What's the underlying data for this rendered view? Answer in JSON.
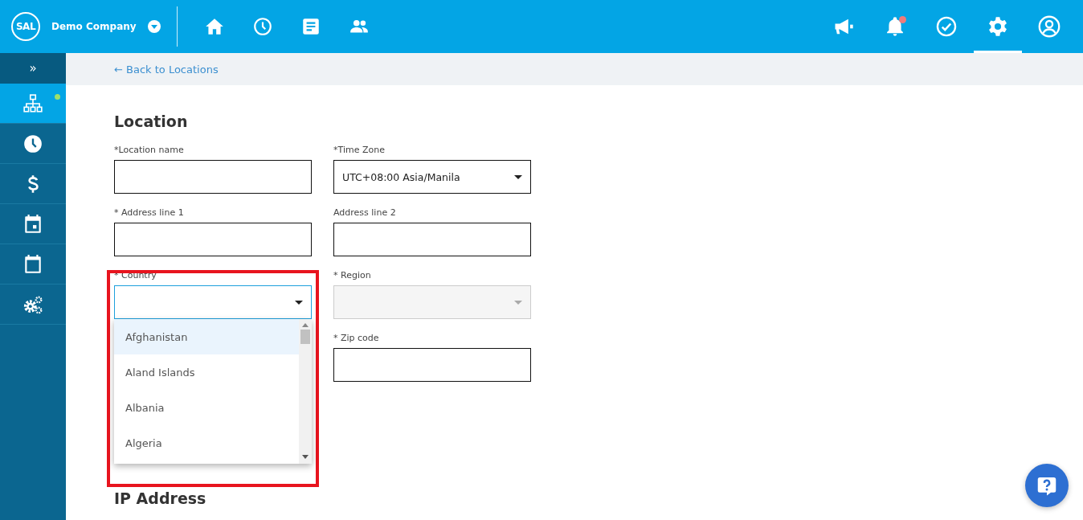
{
  "topbar": {
    "logo": "SAL",
    "company": "Demo Company",
    "nav": [
      {
        "kind": "home"
      },
      {
        "kind": "clock"
      },
      {
        "kind": "document"
      },
      {
        "kind": "people"
      }
    ],
    "actions": [
      {
        "kind": "megaphone",
        "selected": false,
        "notification": false
      },
      {
        "kind": "bell",
        "selected": false,
        "notification": true
      },
      {
        "kind": "check",
        "selected": false,
        "notification": false
      },
      {
        "kind": "settings",
        "selected": true,
        "notification": false
      },
      {
        "kind": "account",
        "selected": false,
        "notification": false
      }
    ]
  },
  "sidebar": {
    "toggle": "»",
    "items": [
      {
        "kind": "org",
        "selected": true,
        "indicator": true
      },
      {
        "kind": "clock",
        "selected": false,
        "indicator": false
      },
      {
        "kind": "dollar",
        "selected": false,
        "indicator": false
      },
      {
        "kind": "calendar-day",
        "selected": false,
        "indicator": false
      },
      {
        "kind": "calendar",
        "selected": false,
        "indicator": false
      },
      {
        "kind": "gears",
        "selected": false,
        "indicator": false
      }
    ]
  },
  "breadcrumb": {
    "link": "← Back to Locations"
  },
  "form": {
    "title": "Location",
    "rows": [
      {
        "fields": [
          {
            "label": "*Location name",
            "kind": "text",
            "disabled": false,
            "open": false
          },
          {
            "label": "*Time Zone",
            "kind": "select",
            "value": "UTC+08:00 Asia/Manila",
            "disabled": false,
            "open": false
          }
        ]
      },
      {
        "fields": [
          {
            "label": "* Address line 1",
            "kind": "text",
            "disabled": false,
            "open": false
          },
          {
            "label": "Address line 2",
            "kind": "text",
            "disabled": false,
            "open": false
          }
        ]
      },
      {
        "fields": [
          {
            "label": "* Country",
            "kind": "select",
            "disabled": false,
            "open": true,
            "options": [
              {
                "label": "Afghanistan",
                "selected": true
              },
              {
                "label": "Aland Islands",
                "selected": false
              },
              {
                "label": "Albania",
                "selected": false
              },
              {
                "label": "Algeria",
                "selected": false
              }
            ]
          },
          {
            "label": "* Region",
            "kind": "select",
            "disabled": true,
            "open": false
          }
        ]
      },
      {
        "fields": [
          {
            "label": "* Zip code",
            "kind": "text",
            "disabled": false,
            "open": false
          }
        ]
      }
    ],
    "section": "IP Address"
  },
  "highlight": true,
  "help": {
    "kind": "help"
  }
}
